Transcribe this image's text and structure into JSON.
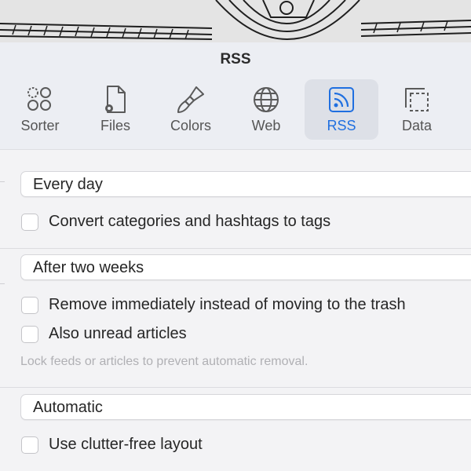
{
  "window": {
    "title": "RSS"
  },
  "tabs": [
    {
      "label": "Sorter",
      "icon": "sorter-icon",
      "active": false
    },
    {
      "label": "Files",
      "icon": "files-icon",
      "active": false
    },
    {
      "label": "Colors",
      "icon": "colors-icon",
      "active": false
    },
    {
      "label": "Web",
      "icon": "web-icon",
      "active": false
    },
    {
      "label": "RSS",
      "icon": "rss-icon",
      "active": true
    },
    {
      "label": "Data",
      "icon": "data-icon",
      "active": false
    }
  ],
  "colors": {
    "accent": "#1f6fe0",
    "toolbar_bg": "#eceef3",
    "active_tab_bg": "#dde0e7"
  },
  "refresh": {
    "selected": "Every day"
  },
  "convert_tags": {
    "label": "Convert categories and hashtags to tags",
    "checked": false
  },
  "removal": {
    "selected": "After two weeks"
  },
  "remove_immediately": {
    "label": "Remove immediately instead of moving to the trash",
    "checked": false
  },
  "also_unread": {
    "label": "Also unread articles",
    "checked": false
  },
  "lock_hint": "Lock feeds or articles to prevent automatic removal.",
  "layout_mode": {
    "selected": "Automatic"
  },
  "clutter_free": {
    "label": "Use clutter-free layout",
    "checked": false
  }
}
